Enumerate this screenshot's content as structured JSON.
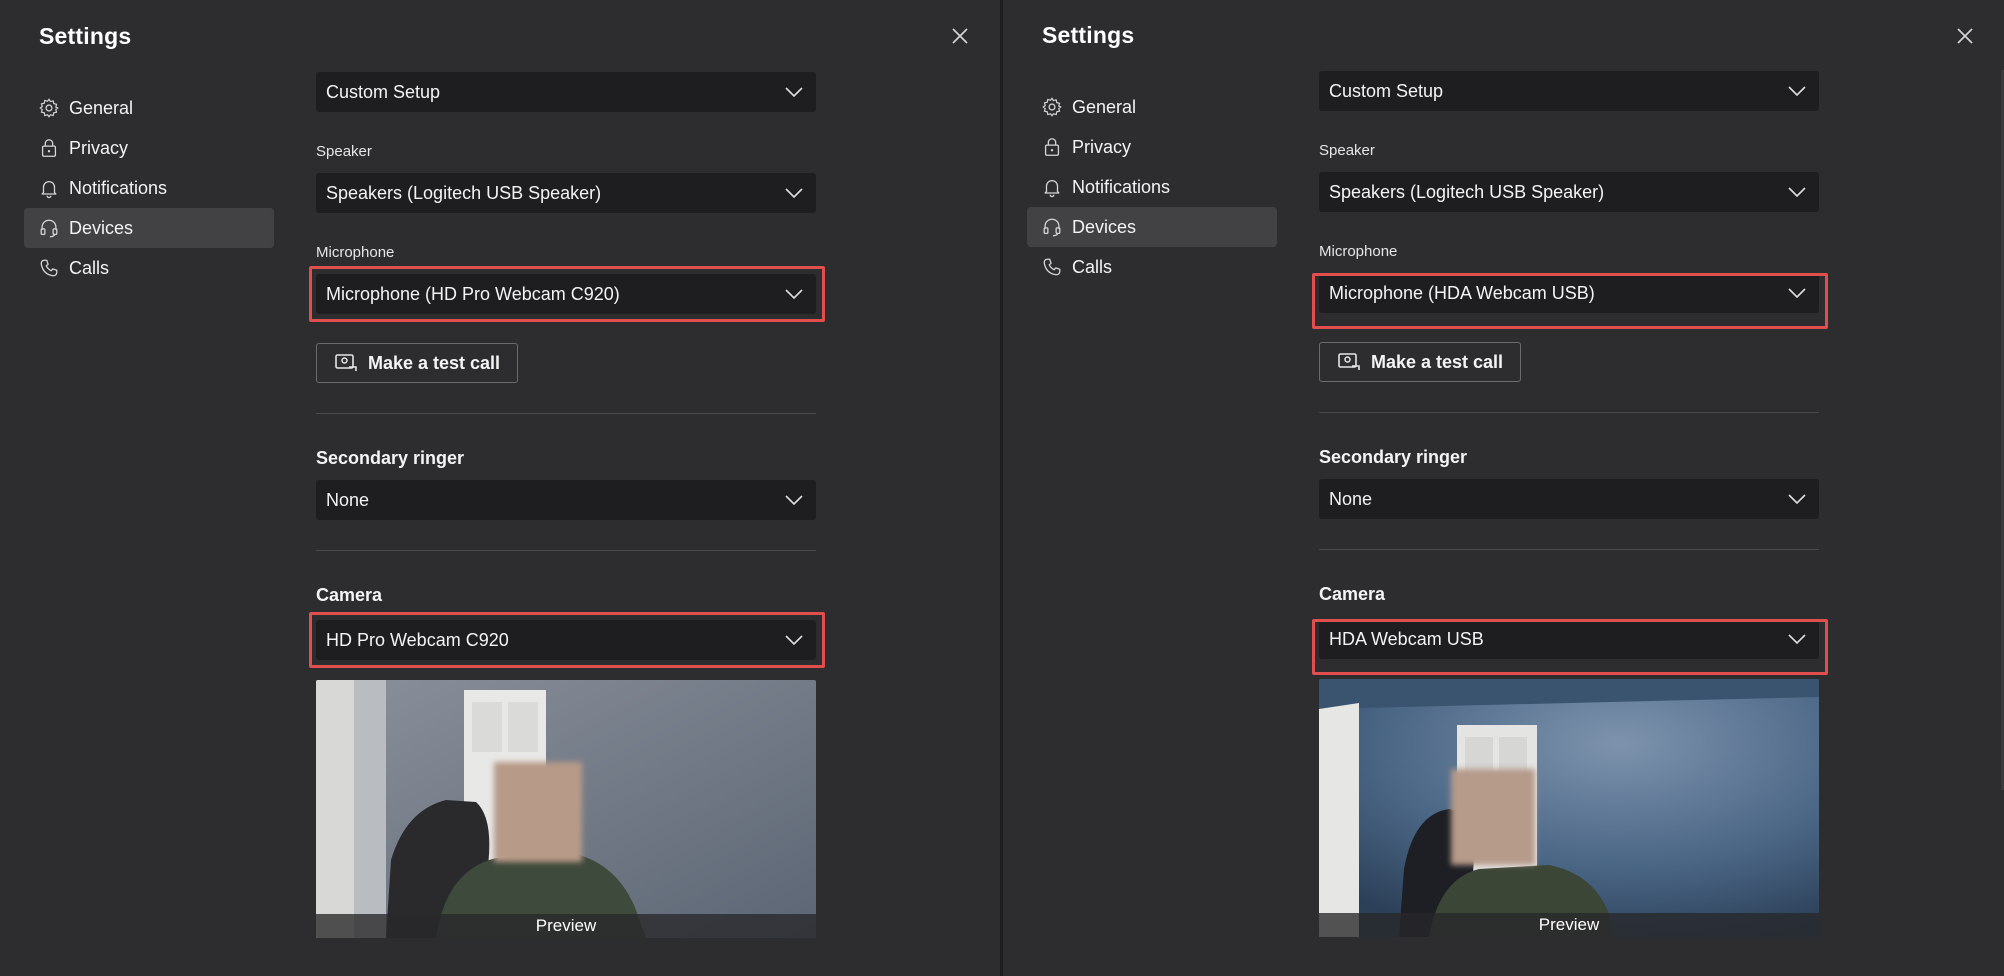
{
  "panels": [
    {
      "title": "Settings",
      "nav": [
        {
          "label": "General",
          "icon": "gear-icon"
        },
        {
          "label": "Privacy",
          "icon": "lock-icon"
        },
        {
          "label": "Notifications",
          "icon": "bell-icon"
        },
        {
          "label": "Devices",
          "icon": "headset-icon",
          "active": true
        },
        {
          "label": "Calls",
          "icon": "phone-icon"
        }
      ],
      "audio_device": "Custom Setup",
      "speaker_label": "Speaker",
      "speaker_value": "Speakers (Logitech USB Speaker)",
      "microphone_label": "Microphone",
      "microphone_value": "Microphone (HD Pro Webcam C920)",
      "test_call_label": "Make a test call",
      "secondary_ringer_label": "Secondary ringer",
      "secondary_ringer_value": "None",
      "camera_label": "Camera",
      "camera_value": "HD Pro Webcam C920",
      "preview_label": "Preview"
    },
    {
      "title": "Settings",
      "nav": [
        {
          "label": "General",
          "icon": "gear-icon"
        },
        {
          "label": "Privacy",
          "icon": "lock-icon"
        },
        {
          "label": "Notifications",
          "icon": "bell-icon"
        },
        {
          "label": "Devices",
          "icon": "headset-icon",
          "active": true
        },
        {
          "label": "Calls",
          "icon": "phone-icon"
        }
      ],
      "audio_device": "Custom Setup",
      "speaker_label": "Speaker",
      "speaker_value": "Speakers (Logitech USB Speaker)",
      "microphone_label": "Microphone",
      "microphone_value": "Microphone (HDA Webcam USB)",
      "test_call_label": "Make a test call",
      "secondary_ringer_label": "Secondary ringer",
      "secondary_ringer_value": "None",
      "camera_label": "Camera",
      "camera_value": "HDA Webcam USB",
      "preview_label": "Preview"
    }
  ],
  "colors": {
    "highlight": "#e14e4e",
    "panel_bg": "#2d2c2e",
    "select_bg": "#1e1d1f",
    "nav_active_bg": "#424144"
  }
}
